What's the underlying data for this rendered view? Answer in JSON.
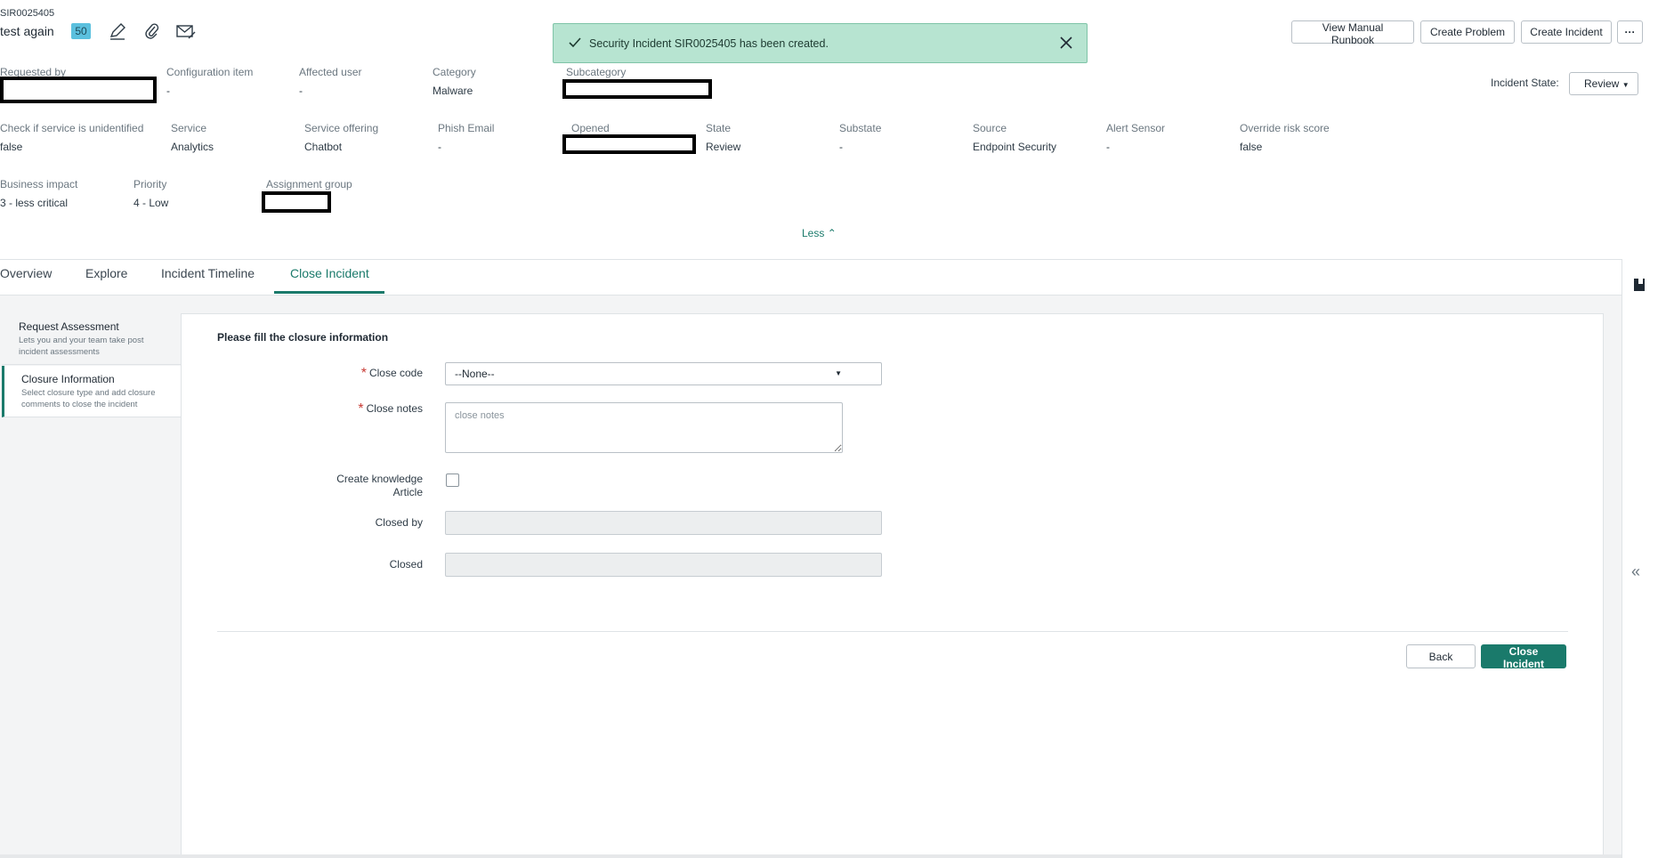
{
  "record": {
    "number": "SIR0025405",
    "title": "test again",
    "score": "50"
  },
  "toast": {
    "message": "Security Incident SIR0025405 has been created."
  },
  "actions": {
    "view_runbook": "View Manual Runbook",
    "create_problem": "Create Problem",
    "create_incident": "Create Incident",
    "more": "···"
  },
  "incident_state": {
    "label": "Incident State:",
    "value": "Review"
  },
  "fields_row1": {
    "requested_by": "Requested by",
    "config_item": "Configuration item",
    "config_item_val": "-",
    "affected_user": "Affected user",
    "affected_user_val": "-",
    "category": "Category",
    "category_val": "Malware",
    "subcategory": "Subcategory"
  },
  "fields_row2": {
    "check_service": "Check if service is unidentified",
    "check_service_val": "false",
    "service": "Service",
    "service_val": "Analytics",
    "service_offering": "Service offering",
    "service_offering_val": "Chatbot",
    "phish_email": "Phish Email",
    "phish_email_val": "-",
    "opened": "Opened",
    "state": "State",
    "state_val": "Review",
    "substate": "Substate",
    "substate_val": "-",
    "source": "Source",
    "source_val": "Endpoint Security",
    "alert_sensor": "Alert Sensor",
    "alert_sensor_val": "-",
    "override_risk": "Override risk score",
    "override_risk_val": "false"
  },
  "fields_row3": {
    "business_impact": "Business impact",
    "business_impact_val": "3 - less critical",
    "priority": "Priority",
    "priority_val": "4 - Low",
    "assignment_group": "Assignment group"
  },
  "less_label": "Less",
  "tabs": [
    {
      "label": "Overview"
    },
    {
      "label": "Explore"
    },
    {
      "label": "Incident Timeline"
    },
    {
      "label": "Close Incident"
    }
  ],
  "side_nav": [
    {
      "title": "Request Assessment",
      "desc": "Lets you and your team take post incident assessments"
    },
    {
      "title": "Closure Information",
      "desc": "Select closure type and add closure comments to close the incident"
    }
  ],
  "form": {
    "heading": "Please fill the closure information",
    "close_code_label": "Close code",
    "close_code_value": "--None--",
    "close_notes_label": "Close notes",
    "close_notes_placeholder": "close notes",
    "kb_label": "Create knowledge Article",
    "closed_by_label": "Closed by",
    "closed_label": "Closed",
    "back": "Back",
    "close_incident": "Close Incident"
  },
  "colors": {
    "accent": "#1a7a6b",
    "toast_bg": "#b7e4d1",
    "required": "#c83c36",
    "badge": "#5bc0de"
  }
}
